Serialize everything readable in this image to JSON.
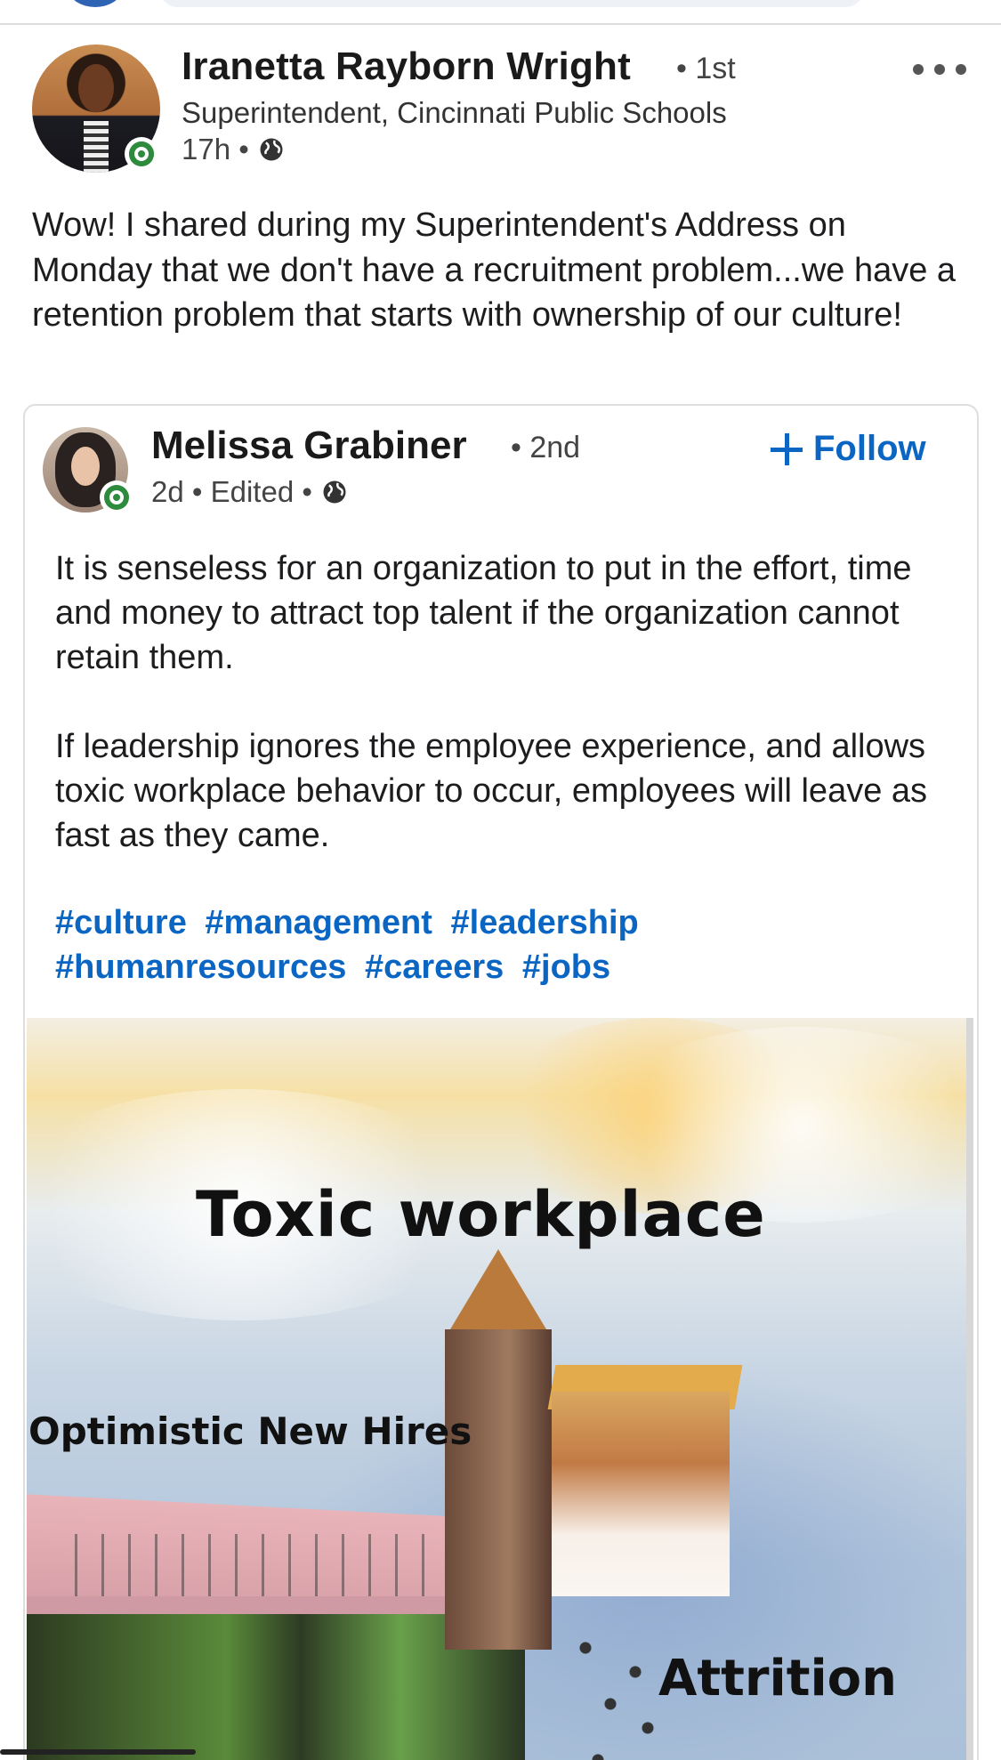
{
  "author": {
    "name": "Iranetta Rayborn Wright",
    "degree": "• 1st",
    "title": "Superintendent, Cincinnati Public Schools",
    "time": "17h •",
    "visibility_icon": "globe-icon",
    "avatar_alt": "profile photo"
  },
  "post": {
    "text": "Wow! I shared during my Superintendent's Address on Monday that we don't have a recruitment problem...we have a retention problem that starts with ownership of our culture!"
  },
  "shared": {
    "name": "Melissa Grabiner",
    "degree": "• 2nd",
    "meta": "2d • Edited •",
    "follow_label": "Follow",
    "paragraph1": "It is senseless for an organization to put in the effort, time and money to attract top talent if the organization cannot retain them.",
    "paragraph2": "If leadership ignores the employee experience, and allows toxic workplace behavior to occur, employees will leave as fast as they came.",
    "hashtags": [
      "#culture",
      "#management",
      "#leadership",
      "#humanresources",
      "#careers",
      "#jobs"
    ],
    "image": {
      "title_text": "Toxic workplace",
      "left_label": "Optimistic New Hires",
      "right_label": "Attrition"
    }
  },
  "colors": {
    "link": "#0a66c2",
    "online": "#2e8b3e"
  }
}
